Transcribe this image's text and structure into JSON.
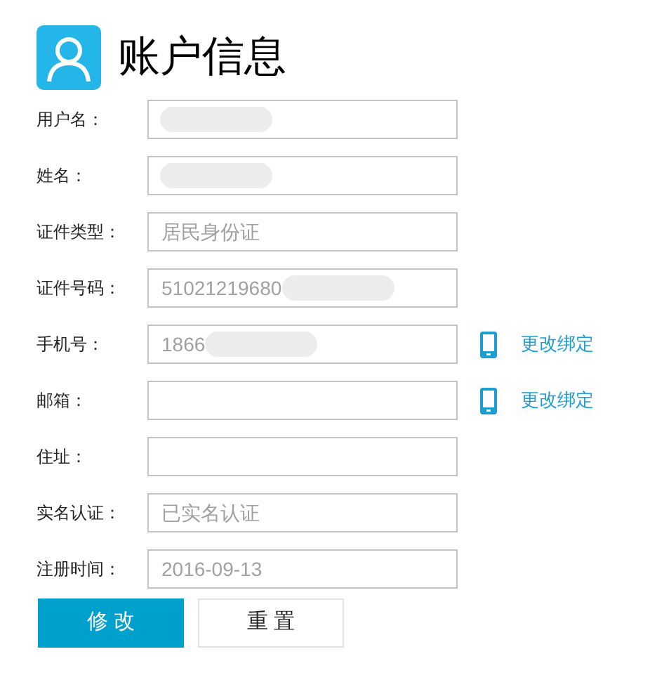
{
  "title": "账户信息",
  "fields": [
    {
      "label": "用户名：",
      "redacted": true
    },
    {
      "label": "姓名：",
      "redacted": true
    },
    {
      "label": "证件类型：",
      "value": "居民身份证",
      "redacted": false
    },
    {
      "label": "证件号码：",
      "value": "51021219680",
      "redacted": true
    },
    {
      "label": "手机号：",
      "value": "1866",
      "redacted": true,
      "action": "更改绑定"
    },
    {
      "label": "邮箱：",
      "redacted": false,
      "action": "更改绑定"
    },
    {
      "label": "住址：",
      "redacted": false
    },
    {
      "label": "实名认证：",
      "value": "已实名认证",
      "redacted": false
    },
    {
      "label": "注册时间：",
      "value": "2016-09-13",
      "redacted": false
    }
  ],
  "buttons": [
    {
      "label": "修 改",
      "kind": "primary"
    },
    {
      "label": "重 置",
      "kind": "secondary"
    }
  ]
}
